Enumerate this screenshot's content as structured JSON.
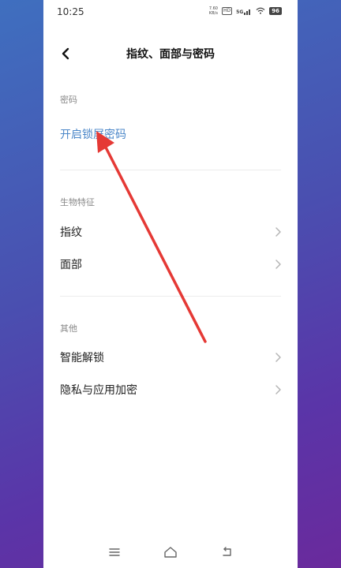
{
  "status_bar": {
    "time": "10:25",
    "net_speed_value": "7.60",
    "net_speed_unit": "KB/s",
    "hd_badge": "HD",
    "signal_label": "5G",
    "battery": "96"
  },
  "header": {
    "title": "指纹、面部与密码"
  },
  "sections": {
    "password": {
      "label": "密码",
      "action": "开启锁屏密码"
    },
    "biometrics": {
      "label": "生物特征",
      "items": [
        {
          "label": "指纹"
        },
        {
          "label": "面部"
        }
      ]
    },
    "other": {
      "label": "其他",
      "items": [
        {
          "label": "智能解锁"
        },
        {
          "label": "隐私与应用加密"
        }
      ]
    }
  },
  "colors": {
    "accent": "#4a86c8",
    "annotation_arrow": "#e53935"
  },
  "icons": {
    "back": "chevron-left-icon",
    "item_chevron": "chevron-right-icon",
    "nav_menu": "menu-icon",
    "nav_home": "home-icon",
    "nav_back": "back-icon"
  }
}
